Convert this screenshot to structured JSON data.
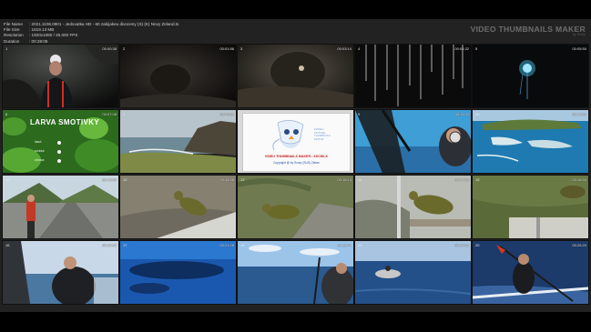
{
  "header": {
    "info": [
      {
        "key": "File Name",
        "value": ": 2021.1106.0901 - Jedovatka HD - 60 zabijakeu divoceny (S) (K) Novy Zeland.ts"
      },
      {
        "key": "File Size",
        "value": ": 1619.13 MB"
      },
      {
        "key": "Resolution",
        "value": ": 1920x1080 / 25.000 FPS"
      },
      {
        "key": "Duration",
        "value": ": 00:28:05"
      }
    ],
    "brand_title": "VIDEO THUMBNAILS MAKER",
    "brand_sub": "by Scorp"
  },
  "thumbs": [
    {
      "tc": "00:00:38",
      "idx": "1"
    },
    {
      "tc": "00:01:56",
      "idx": "2"
    },
    {
      "tc": "00:03:14",
      "idx": "3"
    },
    {
      "tc": "00:04:32",
      "idx": "4"
    },
    {
      "tc": "00:05:50",
      "idx": "5"
    },
    {
      "tc": "00:07:08",
      "idx": "6"
    },
    {
      "tc": "00:08:26",
      "idx": "7"
    },
    {
      "tc": "",
      "idx": ""
    },
    {
      "tc": "00:11:02",
      "idx": "9"
    },
    {
      "tc": "00:12:20",
      "idx": "10"
    },
    {
      "tc": "00:13:38",
      "idx": "11"
    },
    {
      "tc": "00:14:56",
      "idx": "12"
    },
    {
      "tc": "00:16:14",
      "idx": "13"
    },
    {
      "tc": "00:17:32",
      "idx": "14"
    },
    {
      "tc": "00:18:50",
      "idx": "15"
    },
    {
      "tc": "00:20:08",
      "idx": "16"
    },
    {
      "tc": "00:21:26",
      "idx": "17"
    },
    {
      "tc": "00:22:44",
      "idx": "18"
    },
    {
      "tc": "00:24:02",
      "idx": "19"
    },
    {
      "tc": "00:25:20",
      "idx": "20"
    }
  ],
  "larva": {
    "title": "LARVA SMOTIVKY",
    "lines": [
      "lasut:",
      "rostout:",
      "zdrava:"
    ]
  },
  "logo": {
    "title": "VIDEO THUMBNAILS MAKER • XSCHILK",
    "copyright": "Copyright @ by Scorp (SUS) Zlatan",
    "side": [
      "ZVIDEO",
      "PICTURE",
      "THUMBNAILS",
      "EDITOR"
    ]
  }
}
